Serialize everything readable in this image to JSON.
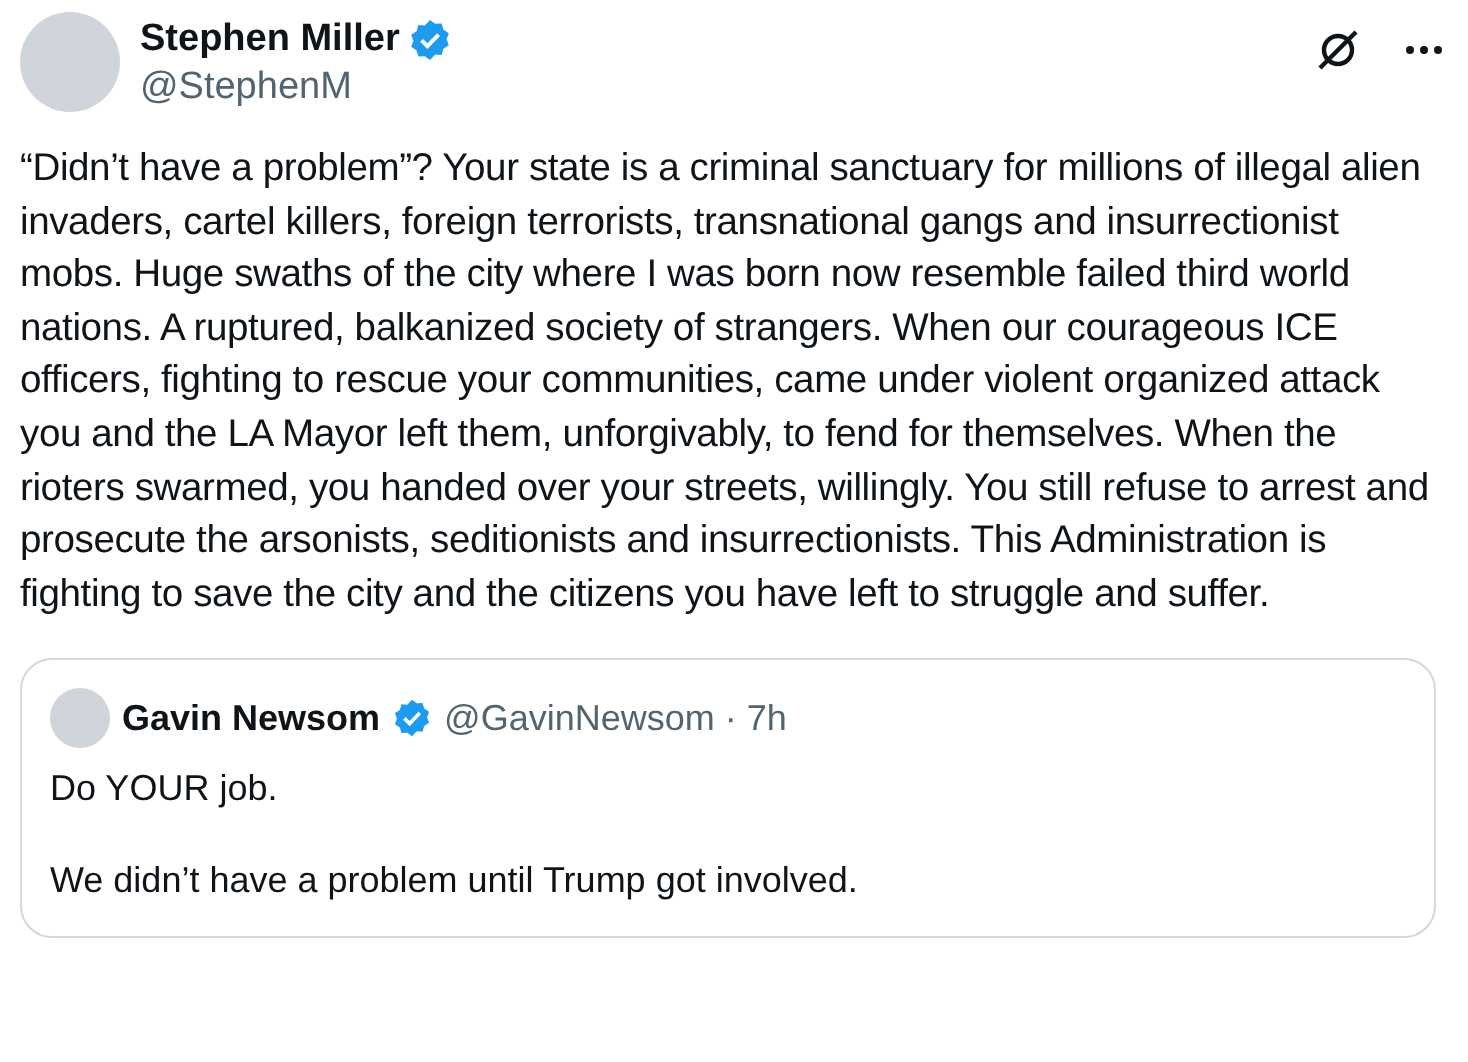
{
  "post": {
    "author": {
      "name": "Stephen Miller",
      "verified": true,
      "handle": "@StephenM"
    },
    "text": "“Didn’t have a problem”? Your state is a criminal sanctuary for millions of illegal alien invaders, cartel killers, foreign terrorists, transnational gangs and insurrectionist mobs. Huge swaths of the city where I was born now resemble failed third world nations. A ruptured, balkanized society of strangers. When our courageous ICE officers, fighting to rescue your communities, came under violent organized attack you and the LA Mayor left them, unforgivably, to fend for themselves. When the rioters swarmed, you handed over your streets, willingly. You still refuse to arrest and prosecute the arsonists, seditionists and insurrectionists. This Administration is fighting to save the city and the citizens you have left to struggle and suffer.",
    "quoted": {
      "author": {
        "name": "Gavin Newsom",
        "verified": true,
        "handle": "@GavinNewsom"
      },
      "separator": "·",
      "time": "7h",
      "paragraphs": [
        "Do YOUR job.",
        "We didn’t have a problem until Trump got involved."
      ]
    }
  }
}
